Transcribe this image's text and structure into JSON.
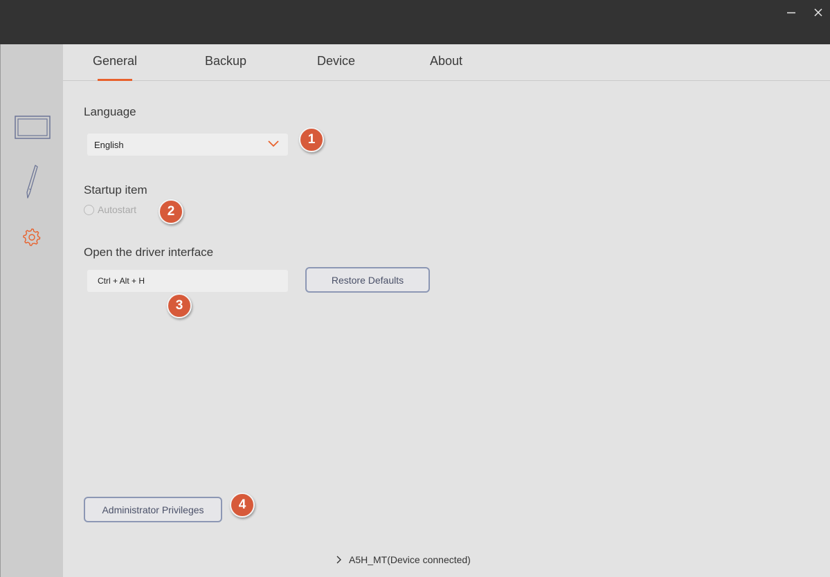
{
  "window": {
    "minimize_icon": "minimize-icon",
    "close_icon": "close-icon"
  },
  "sidebar": {
    "items": [
      {
        "name": "tablet",
        "icon": "tablet-icon"
      },
      {
        "name": "pen",
        "icon": "pen-icon"
      },
      {
        "name": "settings",
        "icon": "gear-icon",
        "active": true
      }
    ]
  },
  "tabs": [
    {
      "label": "General",
      "active": true
    },
    {
      "label": "Backup"
    },
    {
      "label": "Device"
    },
    {
      "label": "About"
    }
  ],
  "language": {
    "label": "Language",
    "value": "English"
  },
  "startup": {
    "label": "Startup item",
    "option_label": "Autostart",
    "checked": false
  },
  "driver": {
    "label": "Open the driver interface",
    "shortcut": "Ctrl + Alt + H",
    "restore_label": "Restore Defaults"
  },
  "admin": {
    "label": "Administrator Privileges"
  },
  "badges": [
    "1",
    "2",
    "3",
    "4"
  ],
  "status": {
    "text": "A5H_MT(Device connected)"
  },
  "colors": {
    "accent": "#e8612c",
    "badge": "#d75a3a",
    "titlebar": "#333333",
    "button_border": "#8c97b4"
  }
}
